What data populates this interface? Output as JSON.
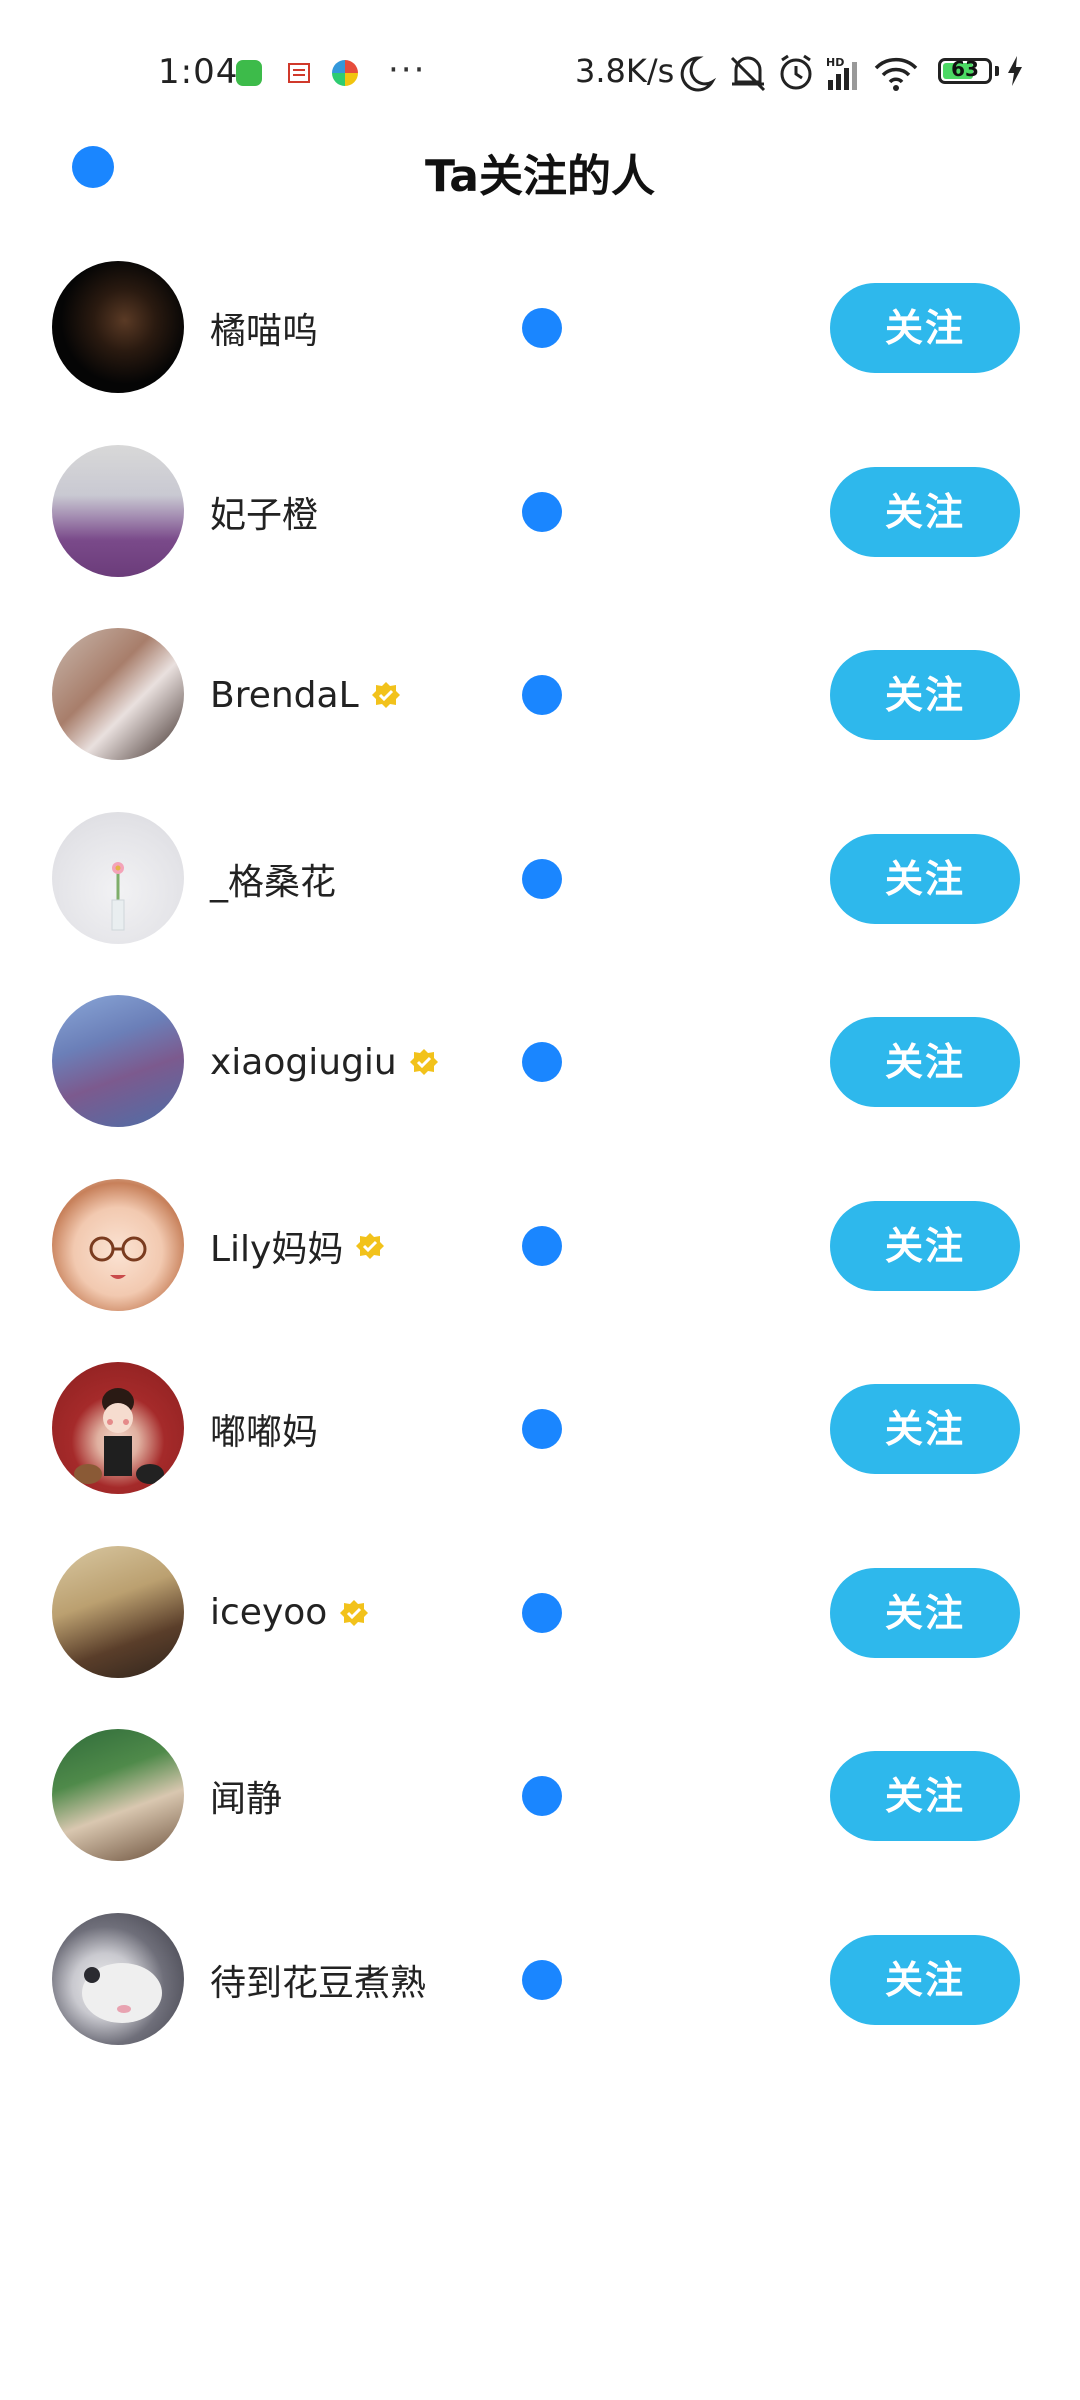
{
  "status_bar": {
    "time": "1:04",
    "overflow_dots": "···",
    "network_speed": "3.8K/s",
    "battery_level": "63",
    "icons": [
      "app-notification-icon",
      "app-notification-icon",
      "app-notification-icon",
      "moon-icon",
      "bell-off-icon",
      "alarm-icon",
      "signal-icon",
      "wifi-icon",
      "battery-icon",
      "charging-icon"
    ]
  },
  "header": {
    "title": "Ta关注的人",
    "back_icon": "back-icon"
  },
  "follow_list": [
    {
      "name": "橘喵呜",
      "verified": false,
      "button": "关注"
    },
    {
      "name": "妃子橙",
      "verified": false,
      "button": "关注"
    },
    {
      "name": "BrendaL",
      "verified": true,
      "button": "关注"
    },
    {
      "name": "_格桑花",
      "verified": false,
      "button": "关注"
    },
    {
      "name": "xiaogiugiu",
      "verified": true,
      "button": "关注"
    },
    {
      "name": "Lily妈妈",
      "verified": true,
      "button": "关注"
    },
    {
      "name": "嘟嘟妈",
      "verified": false,
      "button": "关注"
    },
    {
      "name": "iceyoo",
      "verified": true,
      "button": "关注"
    },
    {
      "name": "闻静",
      "verified": false,
      "button": "关注"
    },
    {
      "name": "待到花豆煮熟",
      "verified": false,
      "button": "关注"
    }
  ],
  "colors": {
    "accent_dot": "#1a86ff",
    "follow_button": "#2eb8ec",
    "verified_badge": "#f2c21b"
  }
}
